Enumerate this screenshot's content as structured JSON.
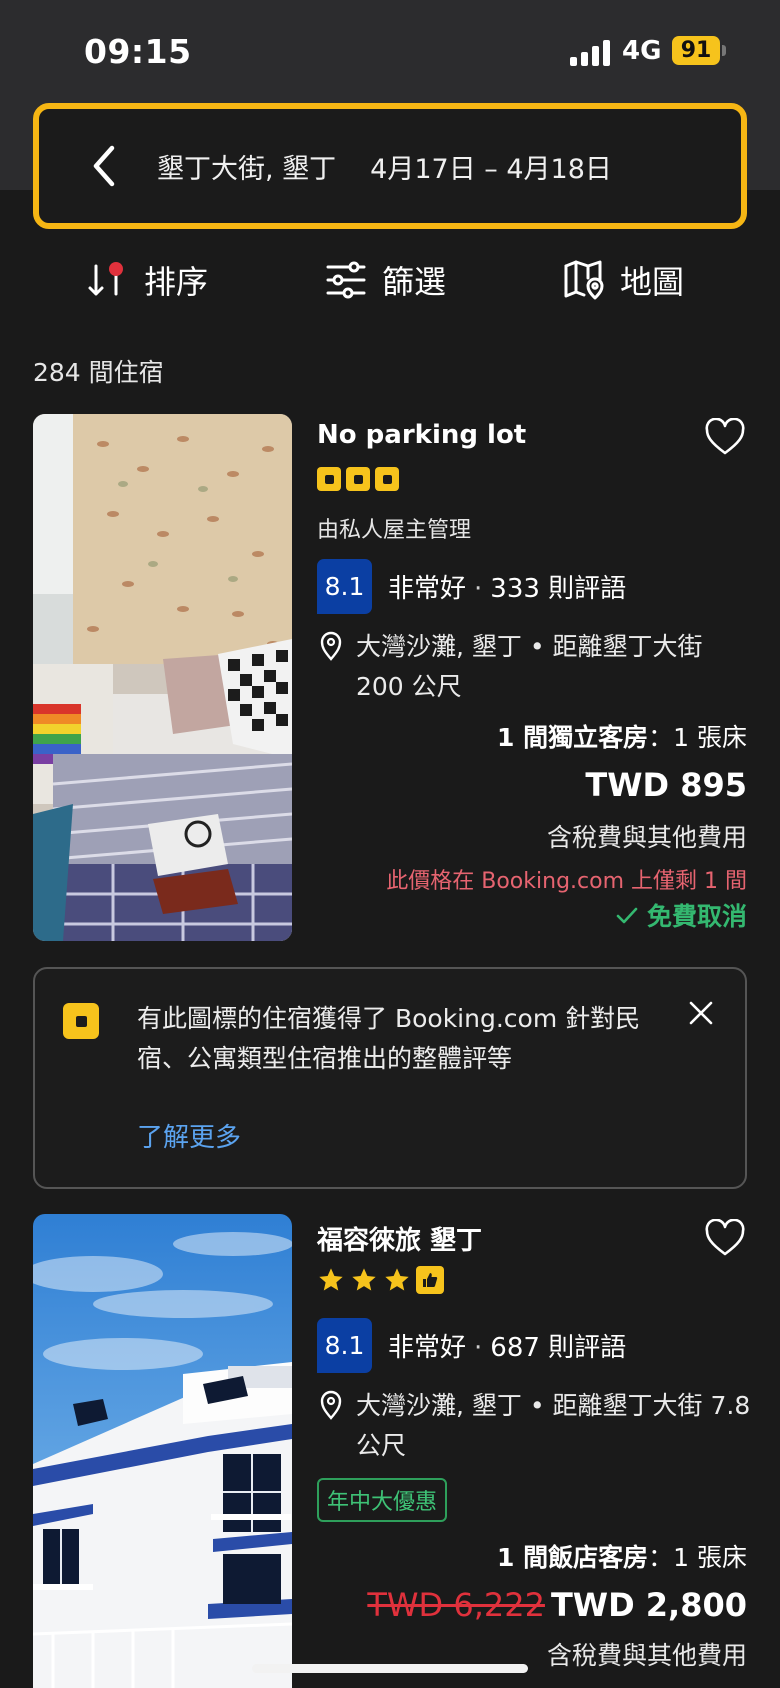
{
  "status_bar": {
    "time": "09:15",
    "network": "4G",
    "battery": "91"
  },
  "search": {
    "location": "墾丁大街, 墾丁",
    "dates": "4月17日 – 4月18日"
  },
  "toolbar": {
    "sort_label": "排序",
    "filter_label": "篩選",
    "map_label": "地圖"
  },
  "results_count": "284 間住宿",
  "listings": [
    {
      "title": "No parking lot",
      "rating_icon_count": 3,
      "managed_by": "由私人屋主管理",
      "score": "8.1",
      "score_word": "非常好",
      "reviews": "333 則評語",
      "location": "大灣沙灘, 墾丁 • 距離墾丁大街 200 公尺",
      "room_type": "1 間獨立客房",
      "beds": "：1 張床",
      "price": "TWD 895",
      "tax_note": "含稅費與其他費用",
      "scarcity": "此價格在 Booking.com 上僅剩 1 間",
      "free_cancellation": "免費取消"
    },
    {
      "title": "福容徠旅 墾丁",
      "stars": 3,
      "score": "8.1",
      "score_word": "非常好",
      "reviews": "687 則評語",
      "location": "大灣沙灘, 墾丁 • 距離墾丁大街 7.8 公尺",
      "deal_badge": "年中大優惠",
      "room_type": "1 間飯店客房",
      "beds": "：1 張床",
      "old_price": "TWD 6,222",
      "price": "TWD 2,800",
      "tax_note": "含稅費與其他費用"
    }
  ],
  "info_box": {
    "text": "有此圖標的住宿獲得了 Booking.com 針對民宿、公寓類型住宿推出的整體評等",
    "link": "了解更多"
  },
  "colors": {
    "accent_yellow": "#f6c31c",
    "score_blue": "#0b3fa3",
    "free_cancel_green": "#34b870",
    "scarcity_red": "#e66470",
    "link_blue": "#5ba3ef"
  }
}
